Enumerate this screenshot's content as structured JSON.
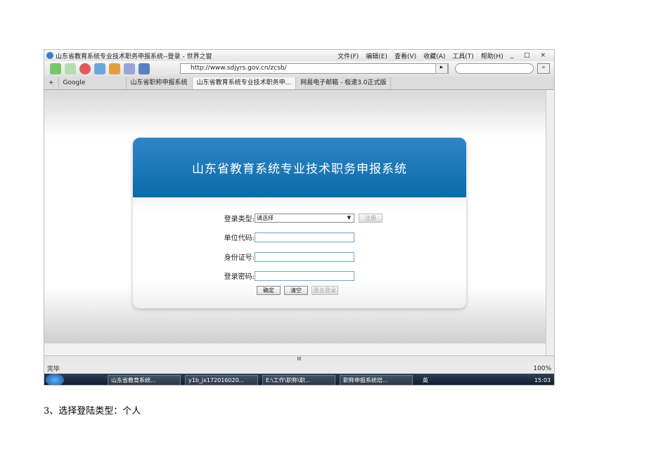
{
  "browser": {
    "title": "山东省教育系统专业技术职务申报系统--登录 - 世界之窗",
    "menu": [
      "文件(F)",
      "编辑(E)",
      "查看(V)",
      "收藏(A)",
      "工具(T)",
      "帮助(H)"
    ],
    "window_controls": "_ □ ×",
    "url": "http://www.sdjyrs.gov.cn/zcsb/",
    "tabs": [
      "Google",
      "山东省职称申报系统",
      "山东省教育系统专业技术职务申...",
      "网易电子邮箱 - 极速3.0正式版"
    ],
    "status": "完毕",
    "zoom": "100%"
  },
  "login": {
    "title": "山东省教育系统专业技术职务申报系统",
    "type_label": "登录类型:",
    "type_value": "请选择",
    "register": "注册",
    "unit_label": "单位代码:",
    "id_label": "身份证号:",
    "pwd_label": "登录密码:",
    "ok": "确定",
    "clear": "清空",
    "anon": "匿名登录"
  },
  "taskbar": {
    "items": [
      "山东省教育系统...",
      "y1b_jx172016020...",
      "E:\\工作\\职称\\职...",
      "职称申报系统培..."
    ],
    "ime": "英",
    "clock": "15:03"
  },
  "caption": "3、选择登陆类型：个人"
}
